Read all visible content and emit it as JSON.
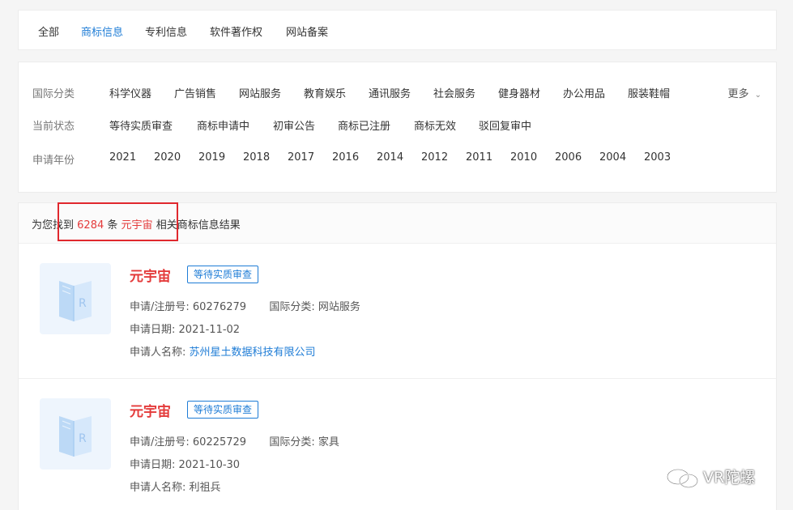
{
  "tabs": [
    "全部",
    "商标信息",
    "专利信息",
    "软件著作权",
    "网站备案"
  ],
  "filters": {
    "class_label": "国际分类",
    "class_options": [
      "科学仪器",
      "广告销售",
      "网站服务",
      "教育娱乐",
      "通讯服务",
      "社会服务",
      "健身器材",
      "办公用品",
      "服装鞋帽"
    ],
    "more": "更多",
    "status_label": "当前状态",
    "status_options": [
      "等待实质审查",
      "商标申请中",
      "初审公告",
      "商标已注册",
      "商标无效",
      "驳回复审中"
    ],
    "year_label": "申请年份",
    "year_options": [
      "2021",
      "2020",
      "2019",
      "2018",
      "2017",
      "2016",
      "2014",
      "2012",
      "2011",
      "2010",
      "2006",
      "2004",
      "2003"
    ]
  },
  "summary": {
    "prefix": "为您找到",
    "count": "6284",
    "unit": "条",
    "keyword": "元宇宙",
    "suffix": "相关商标信息结果"
  },
  "results": [
    {
      "name": "元宇宙",
      "status": "等待实质审查",
      "reg_label": "申请/注册号:",
      "reg_no": "60276279",
      "class_label": "国际分类:",
      "class_value": "网站服务",
      "date_label": "申请日期:",
      "date": "2021-11-02",
      "applicant_label": "申请人名称:",
      "applicant": "苏州星土数据科技有限公司"
    },
    {
      "name": "元宇宙",
      "status": "等待实质审查",
      "reg_label": "申请/注册号:",
      "reg_no": "60225729",
      "class_label": "国际分类:",
      "class_value": "家具",
      "date_label": "申请日期:",
      "date": "2021-10-30",
      "applicant_label": "申请人名称:",
      "applicant": "利祖兵"
    }
  ],
  "watermark": "VR陀螺"
}
